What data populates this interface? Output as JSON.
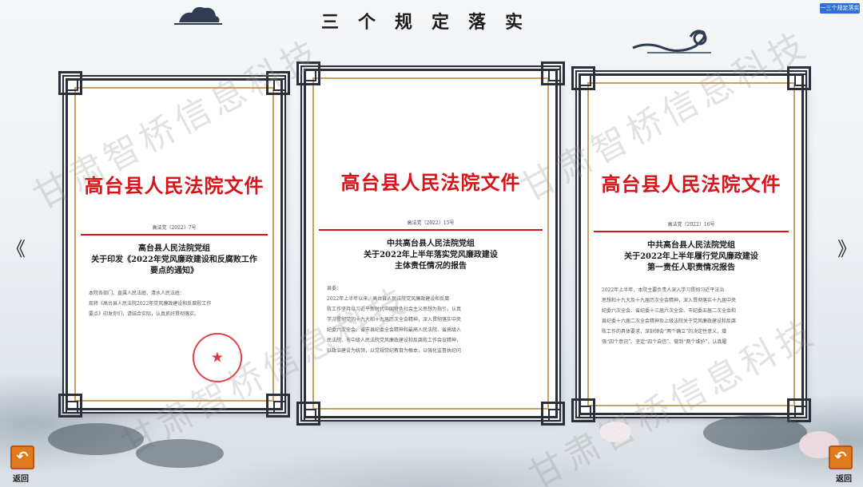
{
  "page": {
    "title": "三个规定落实",
    "top_badge": "一三个规定落实",
    "nav_prev": "《",
    "nav_next": "》",
    "back_label": "返回",
    "back_icon": "undo-arrow-icon",
    "watermark": "甘肃智桥信息科技"
  },
  "colors": {
    "doc_red": "#d6141a",
    "frame": "#2b2f3a",
    "gold_border": "#caa062",
    "back_button": "#e07a1f"
  },
  "documents": [
    {
      "header": "高台县人民法院文件",
      "doc_number": "高法党〔2022〕7号",
      "title_lines": [
        "高台县人民法院党组",
        "关于印发《2022年党风廉政建设和反腐败工作",
        "要点的通知》"
      ],
      "body_lines": [
        "本院各部门、直属人民法庭、清水人民法庭：",
        "现将《高台县人民法院2022年党风廉政建设和反腐败工作",
        "要点》印发你们，请结合实际，认真抓好贯彻落实。"
      ],
      "seal": true
    },
    {
      "header": "高台县人民法院文件",
      "doc_number": "高法党〔2022〕15号",
      "title_lines": [
        "中共高台县人民法院党组",
        "关于2022年上半年落实党风廉政建设",
        "主体责任情况的报告"
      ],
      "body_lines": [
        "县委：",
        "2022年上半年以来，高台县人民法院党风廉政建设和反腐",
        "败工作坚持以习近平新时代中国特色社会主义思想为指引，认真",
        "学习贯彻党的十九大和十九届历次全会精神，深入贯彻落实中央",
        "纪委六次全会、省市县纪委全会精神和最高人民法院、省高级人",
        "民法院、市中级人民法院党风廉政建设和反腐败工作会议精神，",
        "以政治建设为统领，以党规党纪教育为根本，以强化监督执纪问"
      ],
      "seal": false
    },
    {
      "header": "高台县人民法院文件",
      "doc_number": "高法党〔2022〕16号",
      "title_lines": [
        "中共高台县人民法院党组",
        "关于2022年上半年履行党风廉政建设",
        "第一责任人职责情况报告"
      ],
      "body_lines": [
        "2022年上半年，本院主要负责人深入学习贯彻习近平法治",
        "思想和十九大及十九届历次全会精神，深入贯彻落实十九届中央",
        "纪委六次全会、省纪委十三届六次全会、市纪委五届二次全会和",
        "县纪委十六届二次全会精神及上级法院关于党风廉政建设和反腐",
        "败工作的具体要求，深刻领会“两个确立”的决定性意义，增",
        "强“四个意识”、坚定“四个自信”、做到“两个维护”，认真履"
      ],
      "seal": false
    }
  ]
}
